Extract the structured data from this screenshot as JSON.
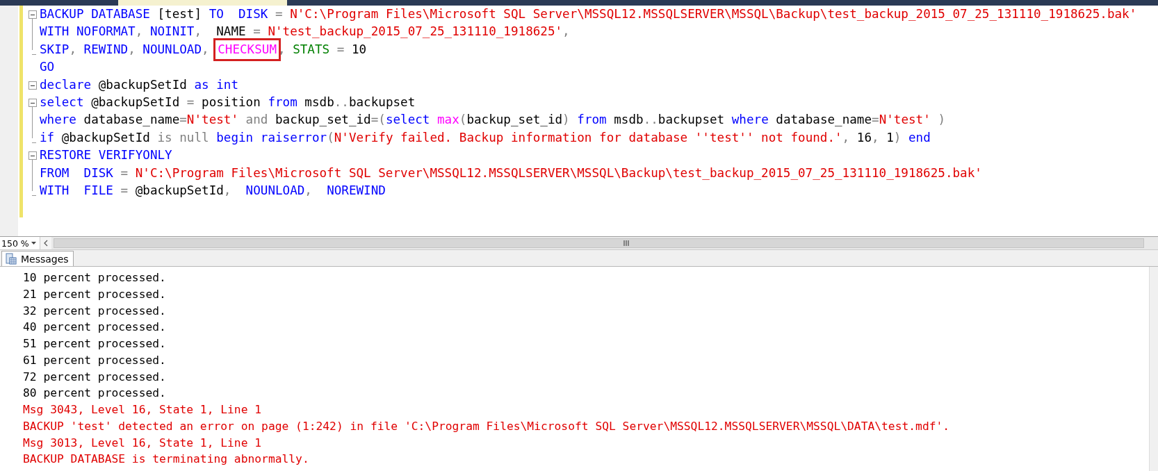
{
  "editor": {
    "lines": [
      {
        "toggle": true,
        "in_block": false,
        "line_below": true,
        "block_end": false,
        "tokens": [
          {
            "kind": "kw",
            "text": "BACKUP "
          },
          {
            "kind": "kw",
            "text": "DATABASE "
          },
          {
            "kind": "id",
            "text": "[test] "
          },
          {
            "kind": "kw",
            "text": "TO  "
          },
          {
            "kind": "kw",
            "text": "DISK "
          },
          {
            "kind": "op",
            "text": "= "
          },
          {
            "kind": "str",
            "text": "N'C:\\Program Files\\Microsoft SQL Server\\MSSQL12.MSSQLSERVER\\MSSQL\\Backup\\test_backup_2015_07_25_131110_1918625.bak'"
          }
        ]
      },
      {
        "toggle": false,
        "in_block": true,
        "line_below": true,
        "block_end": false,
        "tokens": [
          {
            "kind": "kw",
            "text": "WITH "
          },
          {
            "kind": "kw",
            "text": "NOFORMAT"
          },
          {
            "kind": "op",
            "text": ", "
          },
          {
            "kind": "kw",
            "text": "NOINIT"
          },
          {
            "kind": "op",
            "text": ",  "
          },
          {
            "kind": "id",
            "text": "NAME "
          },
          {
            "kind": "op",
            "text": "= "
          },
          {
            "kind": "str",
            "text": "N'test_backup_2015_07_25_131110_1918625'"
          },
          {
            "kind": "op",
            "text": ","
          }
        ]
      },
      {
        "toggle": false,
        "in_block": true,
        "line_below": false,
        "block_end": true,
        "tokens": [
          {
            "kind": "kw",
            "text": "SKIP"
          },
          {
            "kind": "op",
            "text": ", "
          },
          {
            "kind": "kw",
            "text": "REWIND"
          },
          {
            "kind": "op",
            "text": ", "
          },
          {
            "kind": "kw",
            "text": "NOUNLOAD"
          },
          {
            "kind": "op",
            "text": ", "
          },
          {
            "kind": "fn",
            "text": "CHECKSUM",
            "highlighted": true
          },
          {
            "kind": "op",
            "text": ", "
          },
          {
            "kind": "sys",
            "text": "STATS "
          },
          {
            "kind": "op",
            "text": "= "
          },
          {
            "kind": "id",
            "text": "10"
          }
        ]
      },
      {
        "toggle": false,
        "in_block": false,
        "line_below": false,
        "block_end": false,
        "tokens": [
          {
            "kind": "kw",
            "text": "GO"
          }
        ]
      },
      {
        "toggle": true,
        "in_block": false,
        "line_below": false,
        "block_end": false,
        "tokens": [
          {
            "kind": "kw",
            "text": "declare "
          },
          {
            "kind": "id",
            "text": "@backupSetId "
          },
          {
            "kind": "kw",
            "text": "as "
          },
          {
            "kind": "kw",
            "text": "int"
          }
        ]
      },
      {
        "toggle": true,
        "in_block": false,
        "line_below": true,
        "block_end": false,
        "tokens": [
          {
            "kind": "kw",
            "text": "select "
          },
          {
            "kind": "id",
            "text": "@backupSetId "
          },
          {
            "kind": "op",
            "text": "= "
          },
          {
            "kind": "id",
            "text": "position "
          },
          {
            "kind": "kw",
            "text": "from "
          },
          {
            "kind": "id",
            "text": "msdb"
          },
          {
            "kind": "op",
            "text": ".."
          },
          {
            "kind": "id",
            "text": "backupset"
          }
        ]
      },
      {
        "toggle": false,
        "in_block": true,
        "line_below": true,
        "block_end": false,
        "tokens": [
          {
            "kind": "kw",
            "text": "where "
          },
          {
            "kind": "id",
            "text": "database_name"
          },
          {
            "kind": "op",
            "text": "="
          },
          {
            "kind": "str",
            "text": "N'test' "
          },
          {
            "kind": "op",
            "text": "and "
          },
          {
            "kind": "id",
            "text": "backup_set_id"
          },
          {
            "kind": "op",
            "text": "=("
          },
          {
            "kind": "kw",
            "text": "select "
          },
          {
            "kind": "fn",
            "text": "max"
          },
          {
            "kind": "op",
            "text": "("
          },
          {
            "kind": "id",
            "text": "backup_set_id"
          },
          {
            "kind": "op",
            "text": ") "
          },
          {
            "kind": "kw",
            "text": "from "
          },
          {
            "kind": "id",
            "text": "msdb"
          },
          {
            "kind": "op",
            "text": ".."
          },
          {
            "kind": "id",
            "text": "backupset "
          },
          {
            "kind": "kw",
            "text": "where "
          },
          {
            "kind": "id",
            "text": "database_name"
          },
          {
            "kind": "op",
            "text": "="
          },
          {
            "kind": "str",
            "text": "N'test' "
          },
          {
            "kind": "op",
            "text": ")"
          }
        ]
      },
      {
        "toggle": false,
        "in_block": true,
        "line_below": false,
        "block_end": true,
        "tokens": [
          {
            "kind": "kw",
            "text": "if "
          },
          {
            "kind": "id",
            "text": "@backupSetId "
          },
          {
            "kind": "op",
            "text": "is "
          },
          {
            "kind": "op",
            "text": "null "
          },
          {
            "kind": "kw",
            "text": "begin "
          },
          {
            "kind": "kw",
            "text": "raiserror"
          },
          {
            "kind": "op",
            "text": "("
          },
          {
            "kind": "str",
            "text": "N'Verify failed. Backup information for database ''test'' not found.'"
          },
          {
            "kind": "op",
            "text": ", "
          },
          {
            "kind": "id",
            "text": "16"
          },
          {
            "kind": "op",
            "text": ", "
          },
          {
            "kind": "id",
            "text": "1"
          },
          {
            "kind": "op",
            "text": ") "
          },
          {
            "kind": "kw",
            "text": "end"
          }
        ]
      },
      {
        "toggle": true,
        "in_block": false,
        "line_below": true,
        "block_end": false,
        "tokens": [
          {
            "kind": "kw",
            "text": "RESTORE "
          },
          {
            "kind": "kw",
            "text": "VERIFYONLY"
          }
        ]
      },
      {
        "toggle": false,
        "in_block": true,
        "line_below": true,
        "block_end": false,
        "tokens": [
          {
            "kind": "kw",
            "text": "FROM  "
          },
          {
            "kind": "kw",
            "text": "DISK "
          },
          {
            "kind": "op",
            "text": "= "
          },
          {
            "kind": "str",
            "text": "N'C:\\Program Files\\Microsoft SQL Server\\MSSQL12.MSSQLSERVER\\MSSQL\\Backup\\test_backup_2015_07_25_131110_1918625.bak'"
          }
        ]
      },
      {
        "toggle": false,
        "in_block": true,
        "line_below": false,
        "block_end": true,
        "tokens": [
          {
            "kind": "kw",
            "text": "WITH  "
          },
          {
            "kind": "kw",
            "text": "FILE "
          },
          {
            "kind": "op",
            "text": "= "
          },
          {
            "kind": "id",
            "text": "@backupSetId"
          },
          {
            "kind": "op",
            "text": ",  "
          },
          {
            "kind": "kw",
            "text": "NOUNLOAD"
          },
          {
            "kind": "op",
            "text": ",  "
          },
          {
            "kind": "kw",
            "text": "NOREWIND"
          }
        ]
      }
    ]
  },
  "zoom": {
    "value": "150 %"
  },
  "results_tabs": [
    {
      "label": "Messages",
      "selected": true
    }
  ],
  "messages": [
    {
      "kind": "info",
      "text": "10 percent processed."
    },
    {
      "kind": "info",
      "text": "21 percent processed."
    },
    {
      "kind": "info",
      "text": "32 percent processed."
    },
    {
      "kind": "info",
      "text": "40 percent processed."
    },
    {
      "kind": "info",
      "text": "51 percent processed."
    },
    {
      "kind": "info",
      "text": "61 percent processed."
    },
    {
      "kind": "info",
      "text": "72 percent processed."
    },
    {
      "kind": "info",
      "text": "80 percent processed."
    },
    {
      "kind": "error",
      "text": "Msg 3043, Level 16, State 1, Line 1"
    },
    {
      "kind": "error",
      "text": "BACKUP 'test' detected an error on page (1:242) in file 'C:\\Program Files\\Microsoft SQL Server\\MSSQL12.MSSQLSERVER\\MSSQL\\DATA\\test.mdf'."
    },
    {
      "kind": "error",
      "text": "Msg 3013, Level 16, State 1, Line 1"
    },
    {
      "kind": "error",
      "text": "BACKUP DATABASE is terminating abnormally."
    }
  ]
}
